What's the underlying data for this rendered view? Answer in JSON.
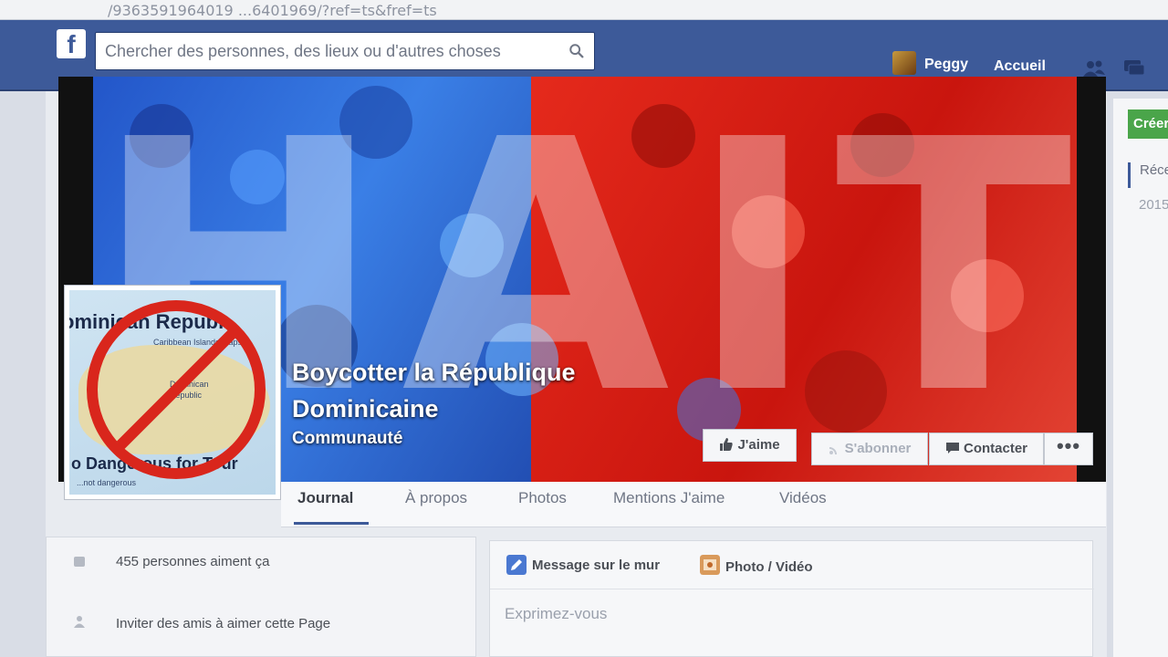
{
  "browser": {
    "url_fragment": "/9363591964019 ...6401969/?ref=ts&fref=ts"
  },
  "header": {
    "logo": "f",
    "search_placeholder": "Chercher des personnes, des lieux ou d'autres choses",
    "user_name": "Peggy",
    "home_label": "Accueil",
    "icons": [
      "search-icon",
      "friends-icon",
      "messages-icon"
    ]
  },
  "cover": {
    "overlay_text": "HAITI",
    "page_name": "Boycotter la République Dominicaine",
    "category": "Communauté",
    "profile_title": "ominican Republ",
    "profile_bottom": "o Dangerous for Tour",
    "profile_small_1": "Caribbean Islands Maps",
    "profile_small_2": "Dominican",
    "profile_small_3": "Republic",
    "profile_small_4": "...not dangerous"
  },
  "actions": {
    "like_label": "J'aime",
    "subscribe_label": "S'abonner",
    "contact_label": "Contacter",
    "more_label": "•••"
  },
  "tabs": [
    {
      "label": "Journal",
      "active": true
    },
    {
      "label": "À propos",
      "active": false
    },
    {
      "label": "Photos",
      "active": false
    },
    {
      "label": "Mentions J'aime",
      "active": false
    },
    {
      "label": "Vidéos",
      "active": false
    }
  ],
  "about": {
    "likes_text": "455 personnes aiment ça",
    "invite_text": "Inviter des amis à aimer cette Page"
  },
  "composer": {
    "status_tab": "Message sur le mur",
    "photo_tab": "Photo / Vidéo",
    "placeholder": "Exprimez-vous"
  },
  "right_column": {
    "create_label": "Créer",
    "recent_label": "Récent",
    "year_label": "2015"
  },
  "colors": {
    "brand_blue": "#3d5a99",
    "green_button": "#4aa54a",
    "ban_red": "#d9261c"
  }
}
